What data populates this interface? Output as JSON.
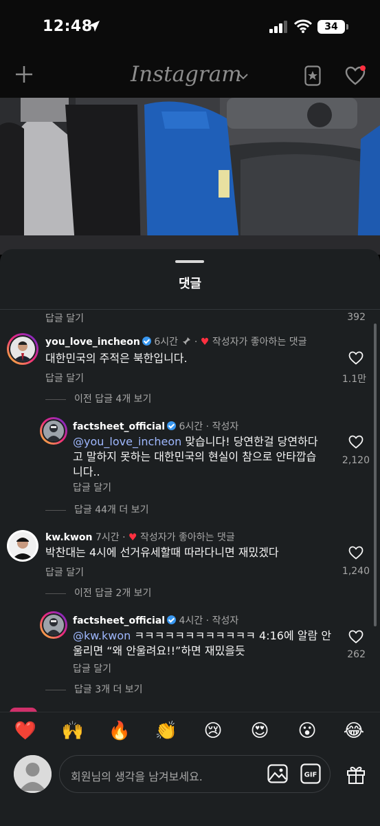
{
  "status_bar": {
    "time": "12:48",
    "battery": "34"
  },
  "header": {
    "logo": "Instagram"
  },
  "sheet": {
    "title": "댓글",
    "top_partial": {
      "reply_label": "답글 달기",
      "like_count": "392"
    }
  },
  "comments": [
    {
      "username": "you_love_incheon",
      "time": "6시간",
      "badge": "작성자가 좋아하는 댓글",
      "text": "대한민국의 주적은 북한입니다.",
      "reply_label": "답글 달기",
      "like_count": "1.1만",
      "more": "이전 답글 4개 보기"
    },
    {
      "username": "factsheet_official",
      "time": "6시간",
      "role": "작성자",
      "mention": "@you_love_incheon",
      "text_line1": " 맞습니다! 당연한걸 당연하다",
      "text_line2": "고 말하지 못하는 대한민국의 현실이 참으로 안타깝습",
      "text_line3": "니다..",
      "reply_label": "답글 달기",
      "like_count": "2,120",
      "more": "답글 44개 더 보기"
    },
    {
      "username": "kw.kwon",
      "time": "7시간",
      "badge": "작성자가 좋아하는 댓글",
      "text": "박찬대는 4시에 선거유세할때 따라다니면 재밌겠다",
      "reply_label": "답글 달기",
      "like_count": "1,240",
      "more": "이전 답글 2개 보기"
    },
    {
      "username": "factsheet_official",
      "time": "4시간",
      "role": "작성자",
      "mention": "@kw.kwon",
      "text_line1": " ㅋㅋㅋㅋㅋㅋㅋㅋㅋㅋㅋㅋ 4:16에 알람 안",
      "text_line2": "울리면 “왜 안울려요!!”하면 재밌을듯",
      "reply_label": "답글 달기",
      "like_count": "262",
      "more": "답글 3개 더 보기"
    }
  ],
  "emoji_bar": [
    "❤️",
    "🙌",
    "🔥",
    "👏",
    "😢",
    "😍",
    "😮",
    "😂"
  ],
  "input": {
    "placeholder": "회원님의 생각을 남겨보세요."
  },
  "icons": {
    "location": "location-arrow-icon",
    "signal": "signal-icon",
    "wifi": "wifi-icon",
    "plus": "plus-icon",
    "saved": "saved-star-icon",
    "heart": "heart-icon",
    "pin": "pin-icon",
    "like": "heart-outline-icon",
    "image": "image-icon",
    "gif": "gif-icon",
    "gift": "gift-icon"
  },
  "colors": {
    "accent_link": "#9fb8ff",
    "verified": "#3897f0",
    "like_red": "#ff3040",
    "sheet_bg": "#1c1f21"
  }
}
